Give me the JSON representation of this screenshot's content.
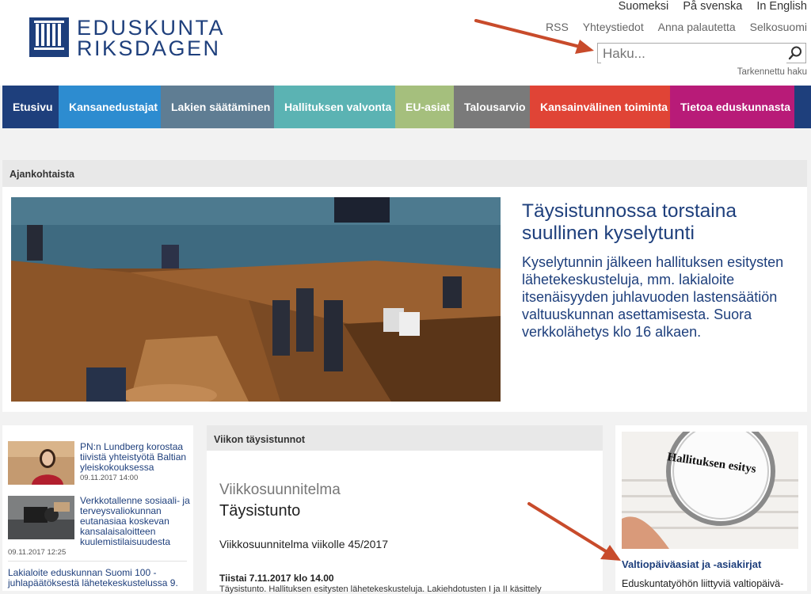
{
  "logo": {
    "line1": "EDUSKUNTA",
    "line2": "RIKSDAGEN"
  },
  "languages": [
    "Suomeksi",
    "På svenska",
    "In English"
  ],
  "top_links": [
    "RSS",
    "Yhteystiedot",
    "Anna palautetta",
    "Selkosuomi"
  ],
  "search": {
    "placeholder": "Haku...",
    "advanced": "Tarkennettu haku"
  },
  "nav": [
    {
      "label": "Etusivu",
      "color": "#1e3f7c"
    },
    {
      "label": "Kansanedustajat",
      "color": "#2d8cd0"
    },
    {
      "label": "Lakien säätäminen",
      "color": "#5f7d93"
    },
    {
      "label": "Hallituksen valvonta",
      "color": "#5bb3b3"
    },
    {
      "label": "EU-asiat",
      "color": "#a5bf7d"
    },
    {
      "label": "Talousarvio",
      "color": "#7a7a7a"
    },
    {
      "label": "Kansainvälinen toiminta",
      "color": "#e04436"
    },
    {
      "label": "Tietoa eduskunnasta",
      "color": "#b81b78"
    }
  ],
  "featured": {
    "header": "Ajankohtaista",
    "title": "Täysistunnossa torstaina suullinen kyselytunti",
    "text": "Kyselytunnin jälkeen hallituksen esitysten lähetekeskusteluja, mm. lakialoite itsenäisyyden juhlavuoden lastensäätiön valtuuskunnan asettamisesta. Suora verkkolähetys klo 16 alkaen."
  },
  "news": [
    {
      "title": "PN:n Lundberg korostaa tiivistä yhteistyötä Baltian yleiskokouksessa",
      "date": "09.11.2017 14:00"
    },
    {
      "title": "Verkkotallenne sosiaali- ja terveysvaliokunnan eutanasiaa koskevan kansalaisaloitteen kuulemistilaisuudesta",
      "date": "09.11.2017 12:25"
    },
    {
      "title": "Lakialoite eduskunnan Suomi 100 -juhlapäätöksestä lähetekeskustelussa 9."
    }
  ],
  "plenary": {
    "header": "Viikon täysistunnot",
    "label": "Viikkosuunnitelma",
    "title": "Täysistunto",
    "subtitle": "Viikkosuunnitelma viikolle 45/2017",
    "date": "Tiistai 7.11.2017 klo 14.00",
    "desc": "Täysistunto. Hallituksen esitysten lähetekeskusteluja. Lakiehdotusten I ja II käsittely"
  },
  "documents": {
    "image_text": "Hallituksen esitys",
    "link": "Valtiopäiväasiat ja -asiakirjat",
    "text": "Eduskuntatyöhön liittyviä valtiopäivä-"
  },
  "colors": {
    "brand": "#1e3f7c",
    "arrow": "#c84b2b"
  }
}
